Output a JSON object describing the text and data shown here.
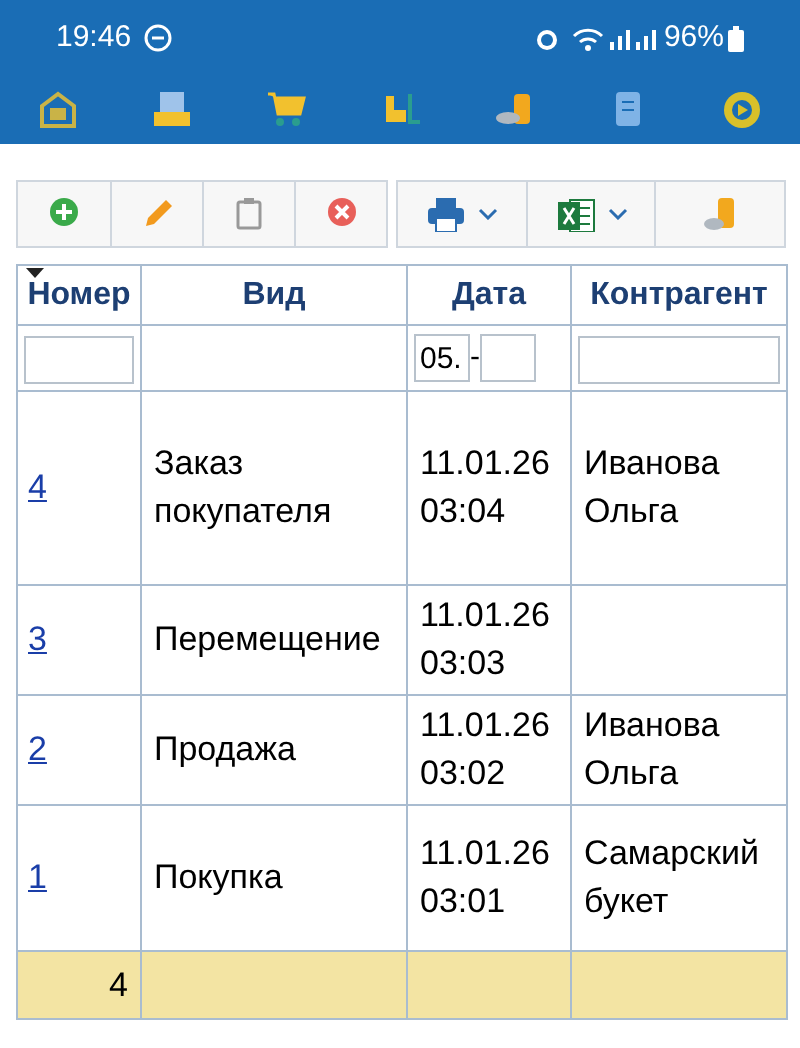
{
  "status_bar": {
    "time": "19:46",
    "battery": "96%"
  },
  "table": {
    "columns": [
      {
        "label": "Номер",
        "sorted": true
      },
      {
        "label": "Вид",
        "sorted": false
      },
      {
        "label": "Дата",
        "sorted": false
      },
      {
        "label": "Контрагент",
        "sorted": false
      }
    ],
    "filters": {
      "date_from": {
        "value": "05."
      },
      "date_separator": "-"
    },
    "rows": [
      {
        "number": "4",
        "kind": "Заказ покупателя",
        "date": "11.01.26",
        "time": "03:04",
        "counterparty": "Иванова Ольга"
      },
      {
        "number": "3",
        "kind": "Перемещение",
        "date": "11.01.26",
        "time": "03:03"
      },
      {
        "number": "2",
        "kind": "Продажа",
        "date": "11.01.26",
        "time": "03:02",
        "counterparty": "Иванова Ольга"
      },
      {
        "number": "1",
        "kind": "Покупка",
        "date": "11.01.26",
        "time": "03:01",
        "counterparty": "Самарский букет"
      }
    ],
    "total": {
      "count": "4"
    }
  }
}
